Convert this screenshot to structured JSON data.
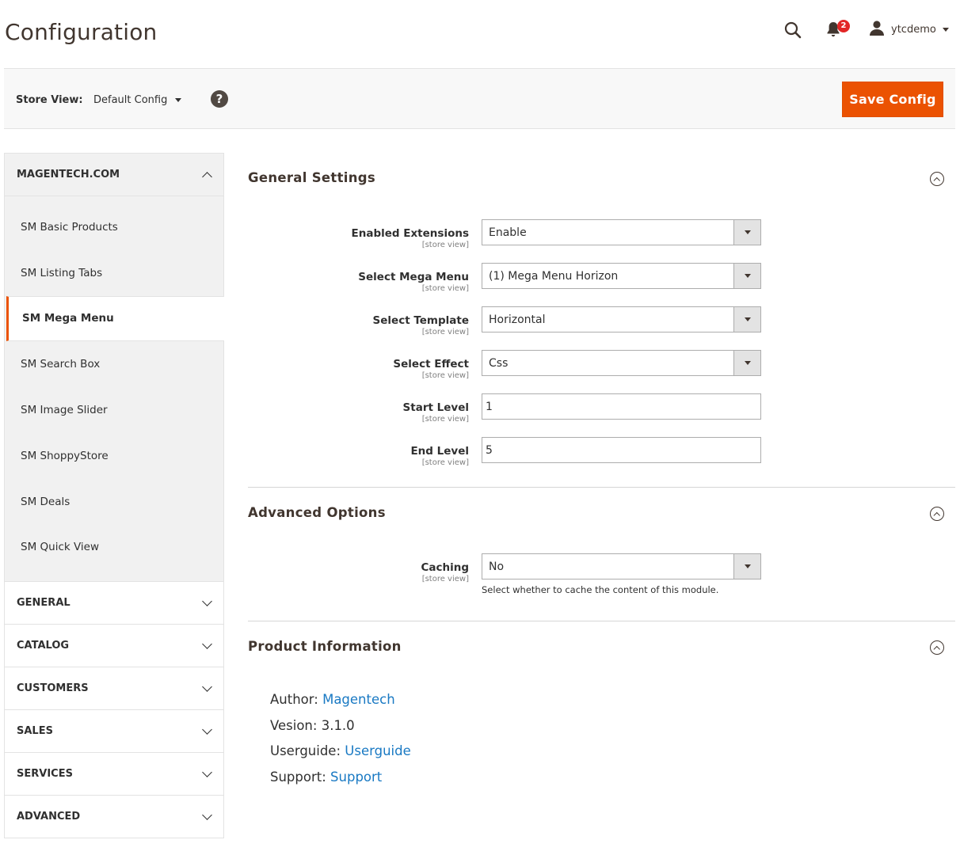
{
  "header": {
    "title": "Configuration",
    "notifications_count": "2",
    "username": "ytcdemo"
  },
  "store_bar": {
    "label": "Store View:",
    "selected": "Default Config",
    "help_glyph": "?",
    "save_label": "Save Config"
  },
  "sidebar": {
    "open_group": {
      "label": "MAGENTECH.COM",
      "items": [
        {
          "label": "SM Basic Products"
        },
        {
          "label": "SM Listing Tabs"
        },
        {
          "label": "SM Mega Menu"
        },
        {
          "label": "SM Search Box"
        },
        {
          "label": "SM Image Slider"
        },
        {
          "label": "SM ShoppyStore"
        },
        {
          "label": "SM Deals"
        },
        {
          "label": "SM Quick View"
        }
      ],
      "active_index": 2
    },
    "groups": [
      {
        "label": "GENERAL"
      },
      {
        "label": "CATALOG"
      },
      {
        "label": "CUSTOMERS"
      },
      {
        "label": "SALES"
      },
      {
        "label": "SERVICES"
      },
      {
        "label": "ADVANCED"
      }
    ]
  },
  "sections": {
    "general": {
      "title": "General Settings",
      "fields": [
        {
          "label": "Enabled Extensions",
          "scope": "[store view]",
          "value": "Enable"
        },
        {
          "label": "Select Mega Menu",
          "scope": "[store view]",
          "value": "(1) Mega Menu Horizon"
        },
        {
          "label": "Select Template",
          "scope": "[store view]",
          "value": "Horizontal"
        },
        {
          "label": "Select Effect",
          "scope": "[store view]",
          "value": "Css"
        },
        {
          "label": "Start Level",
          "scope": "[store view]",
          "value": "1"
        },
        {
          "label": "End Level",
          "scope": "[store view]",
          "value": "5"
        }
      ]
    },
    "advanced": {
      "title": "Advanced Options",
      "caching": {
        "label": "Caching",
        "scope": "[store view]",
        "value": "No",
        "note": "Select whether to cache the content of this module."
      }
    },
    "product": {
      "title": "Product Information",
      "author_label": "Author:",
      "author_link": "Magentech",
      "version": "Vesion: 3.1.0",
      "userguide_label": "Userguide:",
      "userguide_link": "Userguide",
      "support_label": "Support:",
      "support_link": "Support"
    }
  },
  "colors": {
    "accent": "#eb5202",
    "link": "#1979c3",
    "badge": "#e22626"
  }
}
